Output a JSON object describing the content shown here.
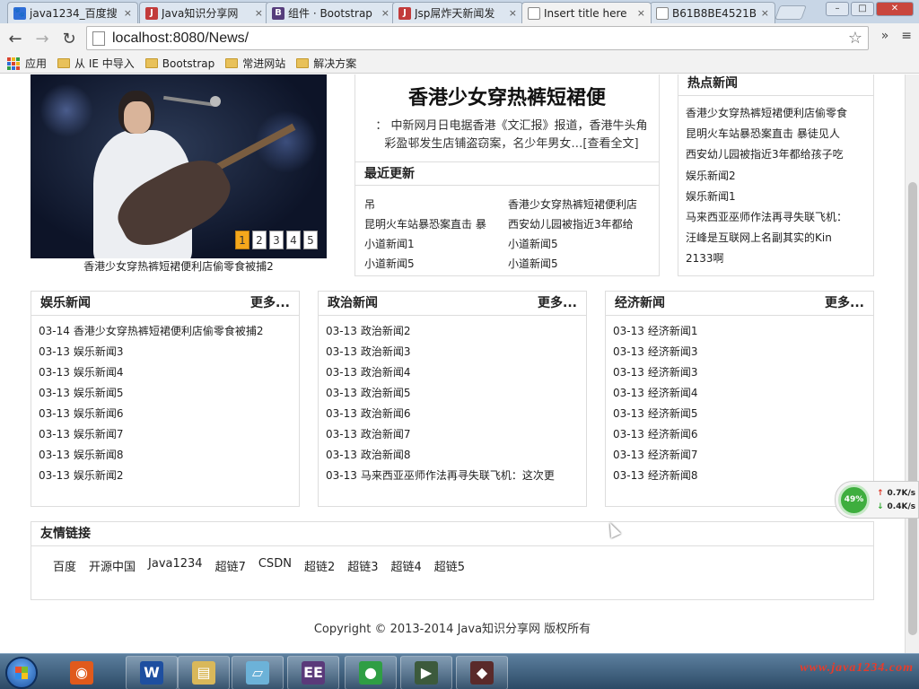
{
  "browser": {
    "tabs": [
      {
        "title": "java1234_百度搜",
        "favicon": "baidu",
        "color": "#2f6ed7",
        "glyph": "🐾",
        "active": false
      },
      {
        "title": "Java知识分享网",
        "favicon": "J",
        "color": "#c23b3b",
        "glyph": "J",
        "active": false
      },
      {
        "title": "组件 · Bootstrap",
        "favicon": "B",
        "color": "#563d7c",
        "glyph": "B",
        "active": false
      },
      {
        "title": "Jsp屌炸天新闻发",
        "favicon": "J",
        "color": "#c23b3b",
        "glyph": "J",
        "active": false
      },
      {
        "title": "Insert title here",
        "favicon": "page",
        "color": "#ffffff",
        "glyph": "",
        "active": true
      },
      {
        "title": "B61B8BE4521B",
        "favicon": "doc",
        "color": "#ffffff",
        "glyph": "",
        "active": false
      }
    ],
    "close_glyph": "×",
    "url": "localhost:8080/News/",
    "bookmarks": [
      "从 IE 中导入",
      "Bootstrap",
      "常进网站",
      "解决方案"
    ],
    "apps_label": "应用",
    "win_min": "–",
    "win_max": "□",
    "win_close": "✕"
  },
  "carousel": {
    "pages": [
      "1",
      "2",
      "3",
      "4",
      "5"
    ],
    "active_page": 1,
    "caption": "香港少女穿热裤短裙便利店偷零食被捕2"
  },
  "headline": {
    "title": "香港少女穿热裤短裙便",
    "summary": "：  中新网月日电据香港《文汇报》报道，香港牛头角彩盈邨发生店铺盗窃案，名少年男女…[查看全文]"
  },
  "latest": {
    "title": "最近更新",
    "items": [
      "吊",
      "香港少女穿热裤短裙便利店",
      "昆明火车站暴恐案直击 暴",
      "西安幼儿园被指近3年都给",
      "小道新闻1",
      "小道新闻5",
      "小道新闻5",
      "小道新闻5"
    ]
  },
  "hot": {
    "title": "热点新闻",
    "items": [
      "香港少女穿热裤短裙便利店偷零食",
      "昆明火车站暴恐案直击 暴徒见人",
      "西安幼儿园被指近3年都给孩子吃",
      "娱乐新闻2",
      "娱乐新闻1",
      "马来西亚巫师作法再寻失联飞机：",
      "汪峰是互联网上名副其实的Kin",
      "2133啊"
    ]
  },
  "categories": [
    {
      "title": "娱乐新闻",
      "more": "更多...",
      "items": [
        {
          "date": "03-14",
          "text": "香港少女穿热裤短裙便利店偷零食被捕2"
        },
        {
          "date": "03-13",
          "text": "娱乐新闻3"
        },
        {
          "date": "03-13",
          "text": "娱乐新闻4"
        },
        {
          "date": "03-13",
          "text": "娱乐新闻5"
        },
        {
          "date": "03-13",
          "text": "娱乐新闻6"
        },
        {
          "date": "03-13",
          "text": "娱乐新闻7"
        },
        {
          "date": "03-13",
          "text": "娱乐新闻8"
        },
        {
          "date": "03-13",
          "text": "娱乐新闻2"
        }
      ]
    },
    {
      "title": "政治新闻",
      "more": "更多...",
      "items": [
        {
          "date": "03-13",
          "text": "政治新闻2"
        },
        {
          "date": "03-13",
          "text": "政治新闻3"
        },
        {
          "date": "03-13",
          "text": "政治新闻4"
        },
        {
          "date": "03-13",
          "text": "政治新闻5"
        },
        {
          "date": "03-13",
          "text": "政治新闻6"
        },
        {
          "date": "03-13",
          "text": "政治新闻7"
        },
        {
          "date": "03-13",
          "text": "政治新闻8"
        },
        {
          "date": "03-13",
          "text": "马来西亚巫师作法再寻失联飞机：这次更"
        }
      ]
    },
    {
      "title": "经济新闻",
      "more": "更多...",
      "items": [
        {
          "date": "03-13",
          "text": "经济新闻1"
        },
        {
          "date": "03-13",
          "text": "经济新闻3"
        },
        {
          "date": "03-13",
          "text": "经济新闻3"
        },
        {
          "date": "03-13",
          "text": "经济新闻4"
        },
        {
          "date": "03-13",
          "text": "经济新闻5"
        },
        {
          "date": "03-13",
          "text": "经济新闻6"
        },
        {
          "date": "03-13",
          "text": "经济新闻7"
        },
        {
          "date": "03-13",
          "text": "经济新闻8"
        }
      ]
    }
  ],
  "links": {
    "title": "友情链接",
    "items": [
      "百度",
      "开源中国",
      "Java1234",
      "超链7",
      "CSDN",
      "超链2",
      "超链3",
      "超链4",
      "超链5"
    ]
  },
  "copyright": "Copyright © 2013-2014 Java知识分享网 版权所有",
  "netwidget": {
    "percent": "49%",
    "up": "0.7K/s",
    "down": "0.4K/s"
  },
  "taskbar": {
    "apps": [
      {
        "name": "office-icon",
        "glyph": "◉",
        "color": "#e05a1c"
      },
      {
        "name": "wps-writer-icon",
        "glyph": "W",
        "color": "#1e4fa0"
      },
      {
        "name": "file-explorer-icon",
        "glyph": "▤",
        "color": "#d9b85a"
      },
      {
        "name": "notepad-icon",
        "glyph": "▱",
        "color": "#6cb2d8"
      },
      {
        "name": "eclipse-ee-icon",
        "glyph": "EE",
        "color": "#5a3a7a"
      },
      {
        "name": "chrome-icon",
        "glyph": "●",
        "color": "#2f9e44"
      },
      {
        "name": "terminal-icon",
        "glyph": "▶",
        "color": "#3c5a3c"
      },
      {
        "name": "tomcat-icon",
        "glyph": "◆",
        "color": "#5a2a2a"
      }
    ],
    "watermark": "www.java1234.com"
  }
}
